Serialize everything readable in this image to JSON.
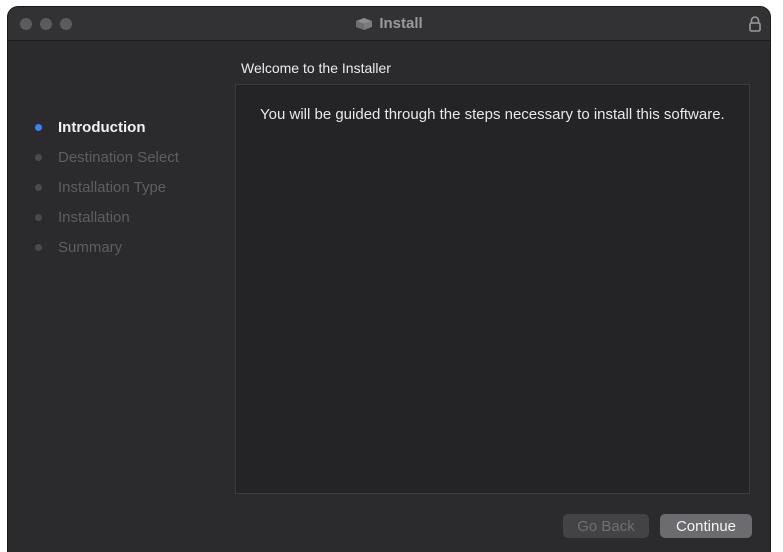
{
  "window": {
    "title": "Install",
    "title_icon": "package-icon",
    "lock_icon": "lock-icon"
  },
  "header": {
    "text": "Welcome to the  Installer"
  },
  "sidebar": {
    "items": [
      {
        "label": "Introduction",
        "state": "current"
      },
      {
        "label": "Destination Select",
        "state": "pending"
      },
      {
        "label": "Installation Type",
        "state": "pending"
      },
      {
        "label": "Installation",
        "state": "pending"
      },
      {
        "label": "Summary",
        "state": "pending"
      }
    ]
  },
  "content": {
    "body": "You will be guided through the steps necessary to install this software."
  },
  "buttons": {
    "back_label": "Go Back",
    "back_enabled": false,
    "continue_label": "Continue"
  },
  "colors": {
    "active_step": "#3b82f6",
    "window_bg": "#2b2b2d",
    "content_bg": "#242426"
  }
}
